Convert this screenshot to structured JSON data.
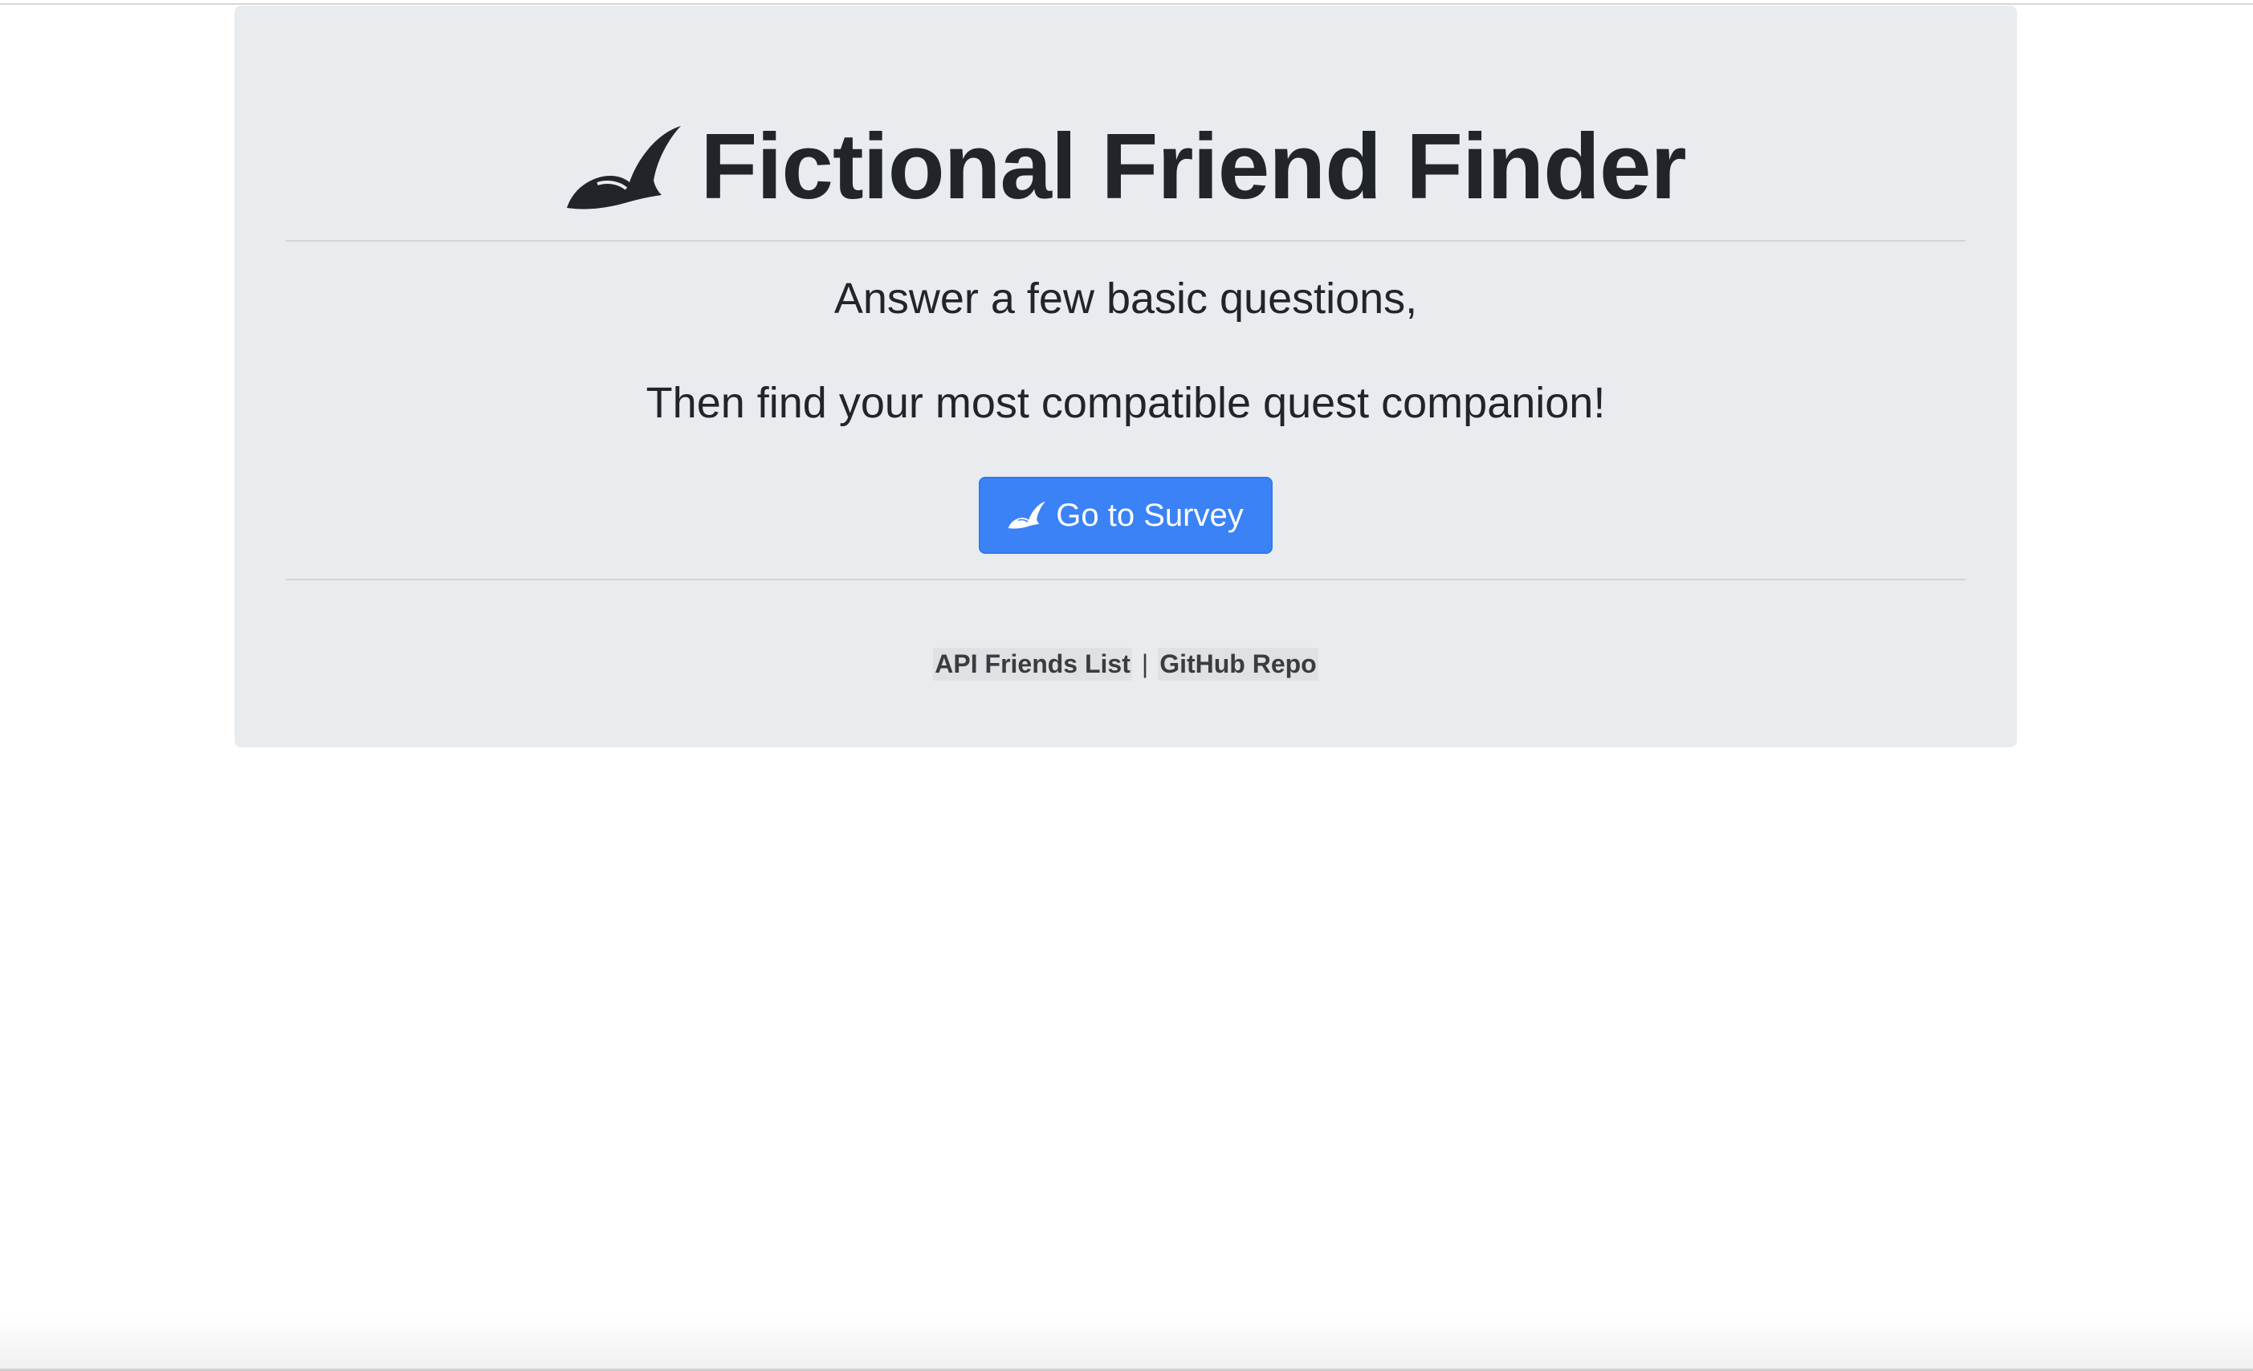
{
  "jumbotron": {
    "title": "Fictional Friend Finder",
    "lead_line_1": "Answer a few basic questions,",
    "lead_line_2": "Then find your most compatible quest companion!",
    "survey_button_label": "Go to Survey",
    "hat_icon": "feathered-hat-icon"
  },
  "footer": {
    "api_link_label": "API Friends List",
    "separator": "|",
    "github_link_label": "GitHub Repo"
  },
  "colors": {
    "jumbotron_bg": "#e9ecef",
    "primary_button": "#3a82f6",
    "text": "#212529"
  }
}
